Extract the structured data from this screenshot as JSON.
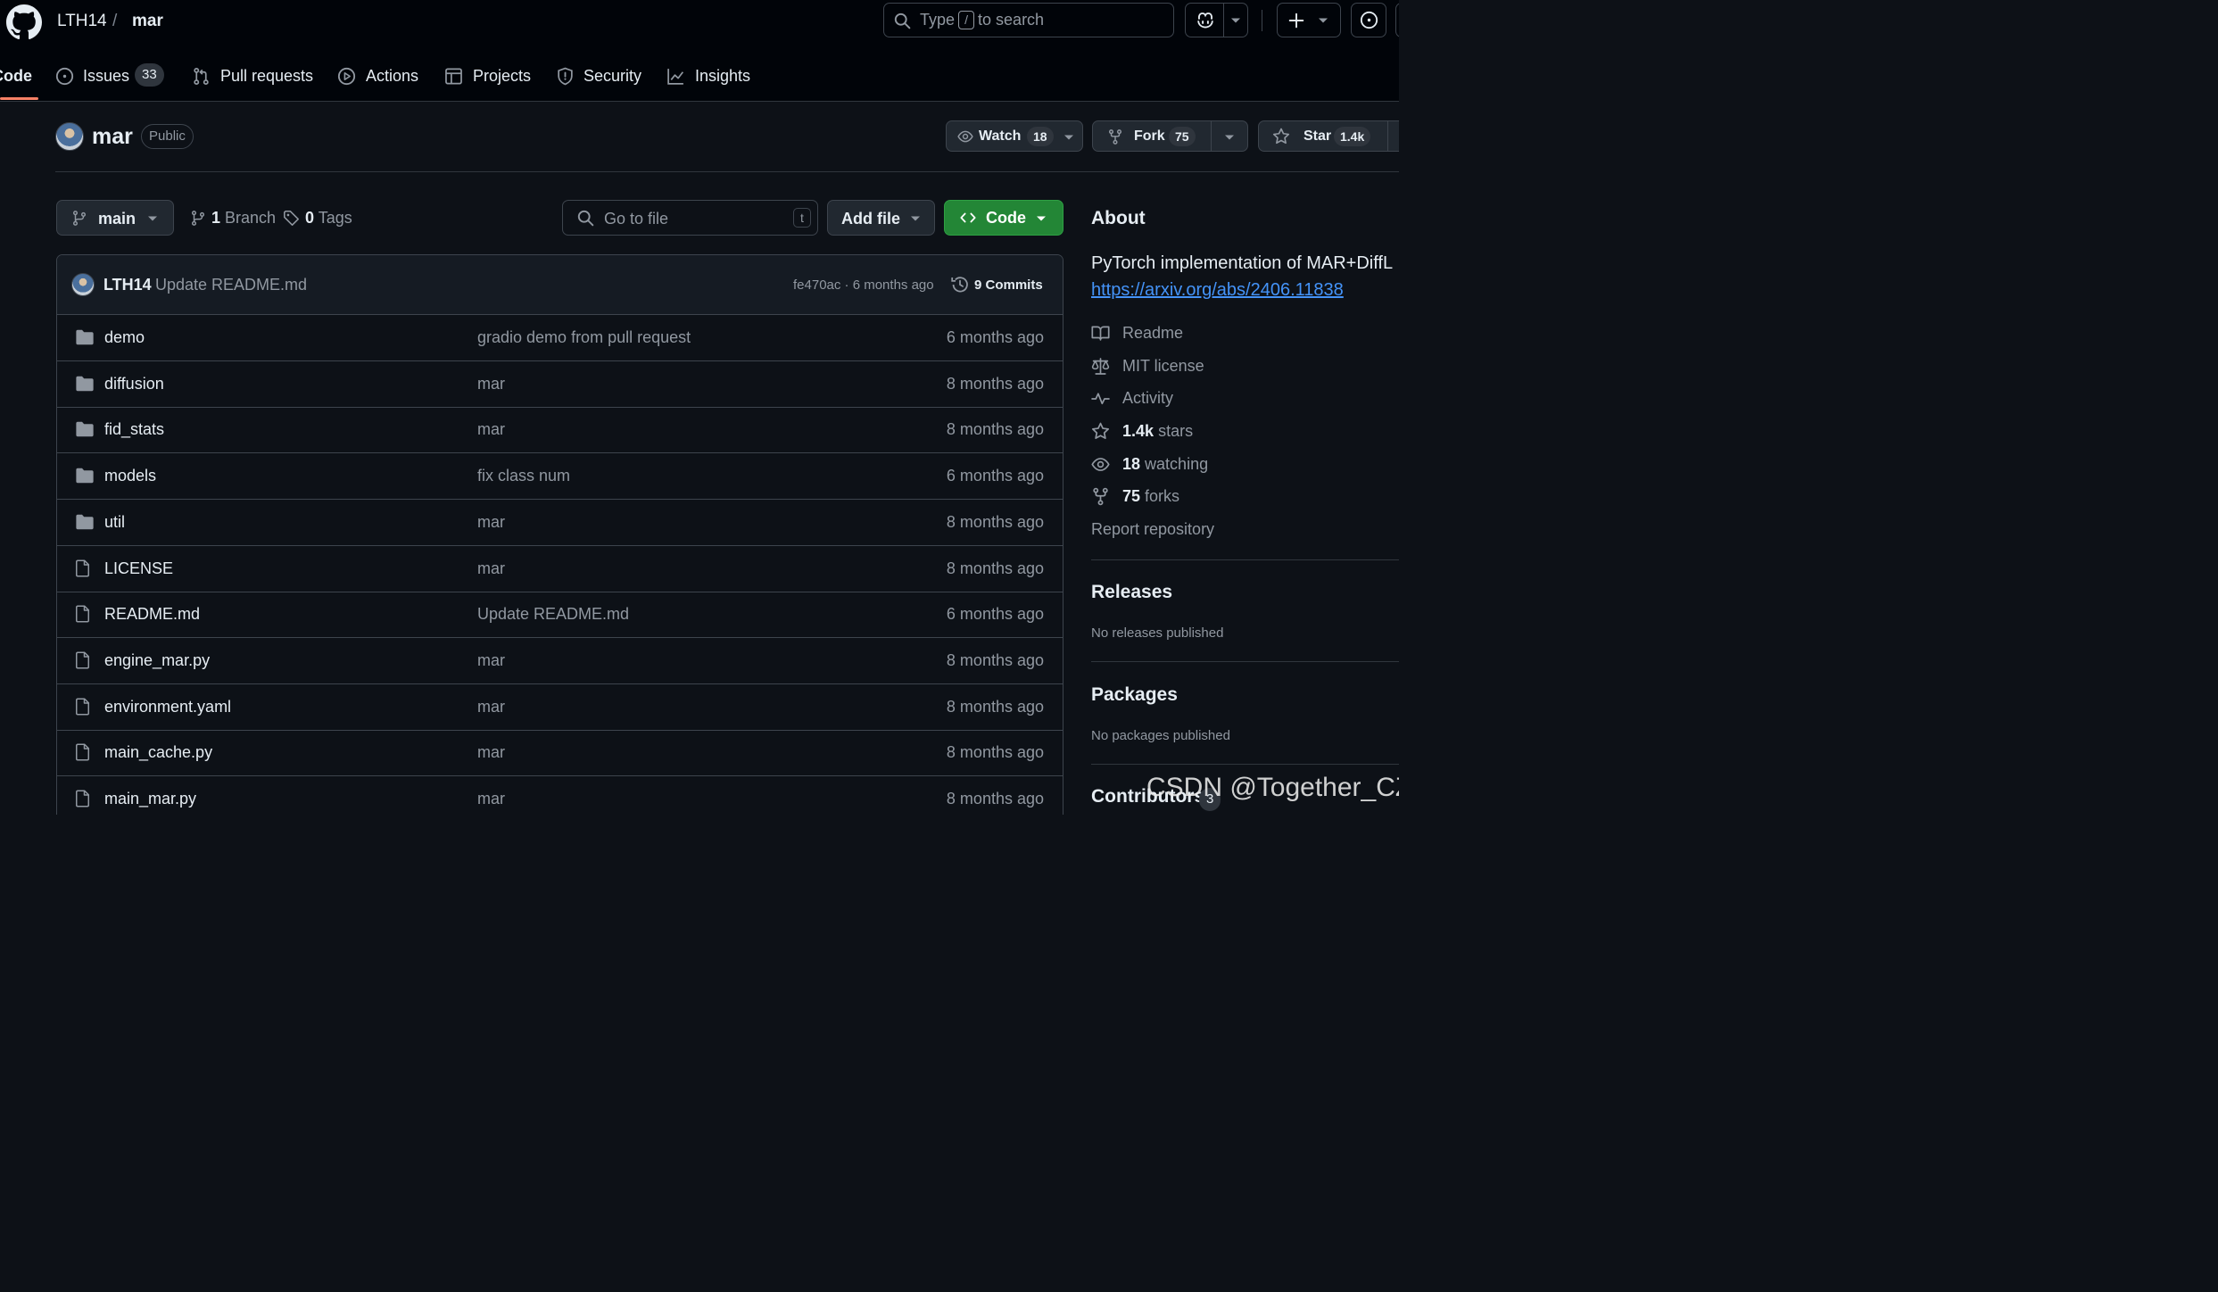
{
  "header": {
    "owner": "LTH14",
    "separator": "/",
    "repo": "mar",
    "search_placeholder_pre": "Type",
    "search_key": "/",
    "search_placeholder_post": "to search"
  },
  "tabs": [
    {
      "label": "Code"
    },
    {
      "label": "Issues",
      "count": "33"
    },
    {
      "label": "Pull requests"
    },
    {
      "label": "Actions"
    },
    {
      "label": "Projects"
    },
    {
      "label": "Security"
    },
    {
      "label": "Insights"
    }
  ],
  "repo": {
    "name": "mar",
    "visibility": "Public",
    "watch_label": "Watch",
    "watch_count": "18",
    "fork_label": "Fork",
    "fork_count": "75",
    "star_label": "Star",
    "star_count": "1.4k"
  },
  "filenav": {
    "branch": "main",
    "branches_count": "1",
    "branches_label": "Branch",
    "tags_count": "0",
    "tags_label": "Tags",
    "goto_placeholder": "Go to file",
    "goto_key": "t",
    "add_file": "Add file",
    "code": "Code"
  },
  "latest_commit": {
    "author": "LTH14",
    "message": "Update README.md",
    "meta": "fe470ac · 6 months ago",
    "commits": "9 Commits"
  },
  "files": [
    {
      "name": "demo",
      "type": "dir",
      "message": "gradio demo from pull request",
      "date": "6 months ago"
    },
    {
      "name": "diffusion",
      "type": "dir",
      "message": "mar",
      "date": "8 months ago"
    },
    {
      "name": "fid_stats",
      "type": "dir",
      "message": "mar",
      "date": "8 months ago"
    },
    {
      "name": "models",
      "type": "dir",
      "message": "fix class num",
      "date": "6 months ago"
    },
    {
      "name": "util",
      "type": "dir",
      "message": "mar",
      "date": "8 months ago"
    },
    {
      "name": "LICENSE",
      "type": "file",
      "message": "mar",
      "date": "8 months ago"
    },
    {
      "name": "README.md",
      "type": "file",
      "message": "Update README.md",
      "date": "6 months ago"
    },
    {
      "name": "engine_mar.py",
      "type": "file",
      "message": "mar",
      "date": "8 months ago"
    },
    {
      "name": "environment.yaml",
      "type": "file",
      "message": "mar",
      "date": "8 months ago"
    },
    {
      "name": "main_cache.py",
      "type": "file",
      "message": "mar",
      "date": "8 months ago"
    },
    {
      "name": "main_mar.py",
      "type": "file",
      "message": "mar",
      "date": "8 months ago"
    }
  ],
  "about": {
    "title": "About",
    "description": "PyTorch implementation of MAR+DiffL",
    "link": "https://arxiv.org/abs/2406.11838",
    "readme": "Readme",
    "license": "MIT license",
    "activity": "Activity",
    "stars_count": "1.4k",
    "stars_label": "stars",
    "watching_count": "18",
    "watching_label": "watching",
    "forks_count": "75",
    "forks_label": "forks",
    "report": "Report repository"
  },
  "releases": {
    "title": "Releases",
    "empty": "No releases published"
  },
  "packages": {
    "title": "Packages",
    "empty": "No packages published"
  },
  "contributors": {
    "title": "Contributors",
    "count": "3"
  },
  "watermark": "CSDN @Together_CZ"
}
